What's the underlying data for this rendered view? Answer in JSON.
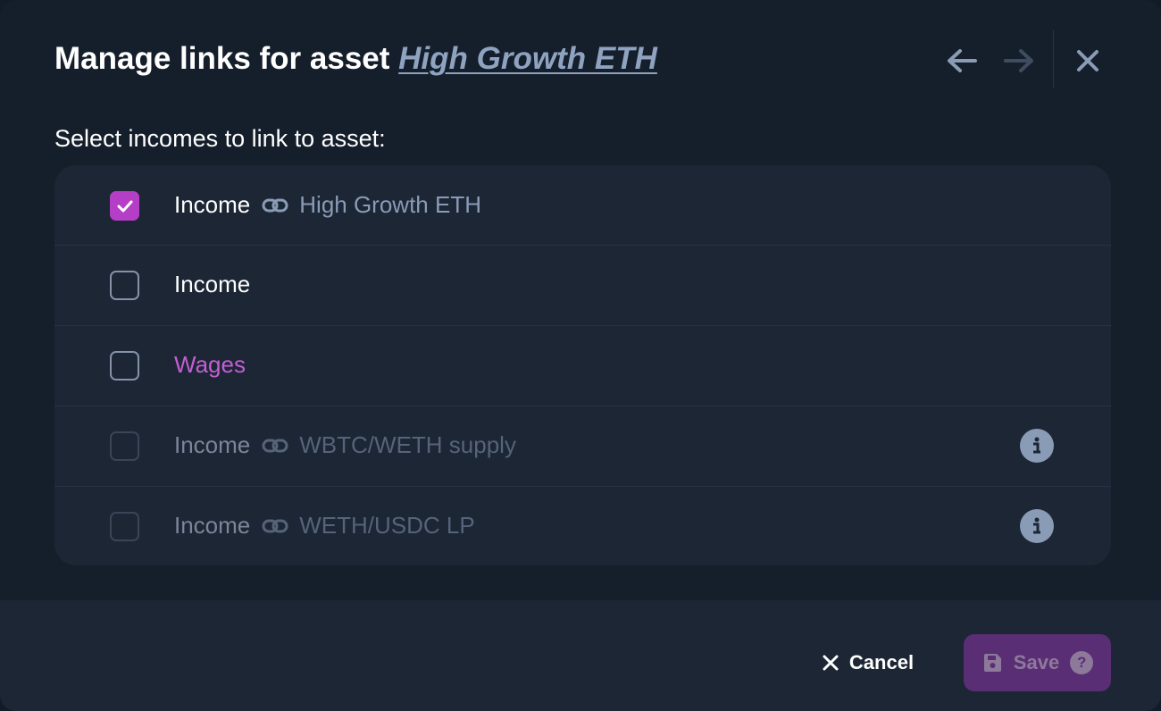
{
  "header": {
    "title_prefix": "Manage links for asset",
    "asset_name": "High Growth ETH"
  },
  "subtitle": "Select incomes to link to asset:",
  "rows": [
    {
      "label": "Income",
      "linked_asset": "High Growth ETH",
      "checked": true,
      "disabled": false
    },
    {
      "label": "Income",
      "linked_asset": "",
      "checked": false,
      "disabled": false
    },
    {
      "label": "Wages",
      "linked_asset": "",
      "checked": false,
      "disabled": false
    },
    {
      "label": "Income",
      "linked_asset": "WBTC/WETH supply",
      "checked": false,
      "disabled": true
    },
    {
      "label": "Income",
      "linked_asset": "WETH/USDC LP",
      "checked": false,
      "disabled": true
    }
  ],
  "footer": {
    "cancel_label": "Cancel",
    "save_label": "Save",
    "save_help": "?"
  },
  "colors": {
    "accent": "#b43ec6",
    "wages": "#c45ed3",
    "link": "#8fa3c0",
    "background": "#151e2b"
  },
  "icons": {
    "back": "arrow-left-icon",
    "forward": "arrow-right-icon",
    "close": "close-icon",
    "link": "link-icon",
    "info": "info-icon",
    "save": "floppy-disk-icon"
  }
}
